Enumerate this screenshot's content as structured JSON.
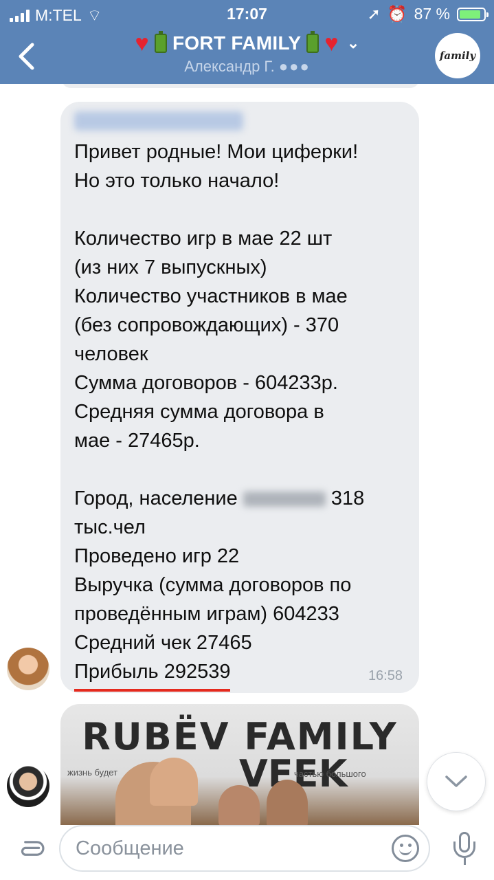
{
  "status_bar": {
    "carrier": "M:TEL",
    "time": "17:07",
    "battery": "87 %",
    "battery_level": 0.87
  },
  "header": {
    "title": "FORT FAMILY",
    "subtitle": "Александр Г.",
    "typing_indicator": "●●●",
    "back_icon": "chevron-left-icon",
    "group_avatar_text": "family",
    "colors": {
      "background": "#5b84b7",
      "heart": "#e5232f"
    }
  },
  "message": {
    "lines": [
      "Привет родные! Мои циферки!",
      "Но это только начало!",
      "",
      "Количество игр в мае 22 шт",
      "(из них 7 выпускных)",
      "Количество участников в мае",
      "(без сопровождающих) - 370",
      "человек",
      "Сумма договоров - 604233р.",
      "Средняя сумма договора в",
      "мае - 27465р.",
      "",
      "Город, население",
      "318",
      "тыс.чел",
      "Проведено игр 22",
      "Выручка (сумма договоров по",
      "проведённым играм) 604233",
      "Средний чек 27465",
      "Прибыль 292539"
    ],
    "time": "16:58",
    "underline_color": "#e52a1e"
  },
  "photo": {
    "title_line1": "RUBЁV FAMILY",
    "title_line2": "VEEK",
    "banner_left": "жизнь будет",
    "banner_right": "частью большого"
  },
  "composer": {
    "placeholder": "Сообщение",
    "value": ""
  }
}
